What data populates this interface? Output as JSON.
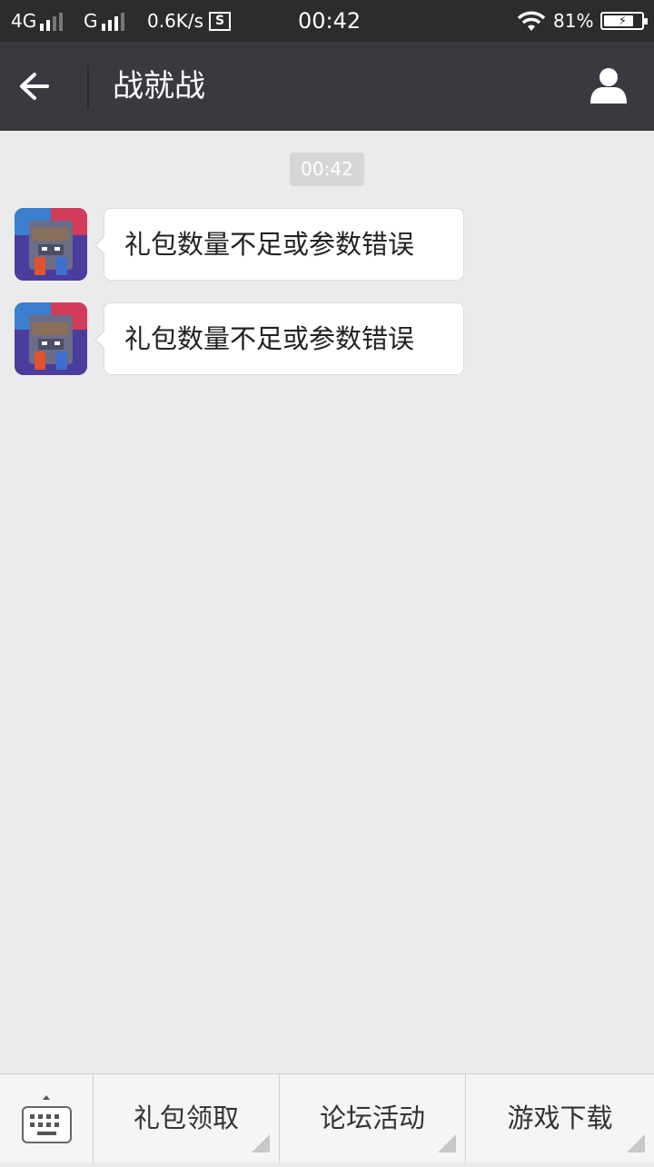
{
  "status_bar": {
    "network1": "4G",
    "network2": "G",
    "speed": "0.6K/s",
    "s_badge": "S",
    "time": "00:42",
    "battery_percent": "81%",
    "battery_level": 0.81,
    "icons": [
      "signal-icon",
      "wifi-icon",
      "battery-charging-icon"
    ]
  },
  "header": {
    "title": "战就战",
    "back_icon": "arrow-left-icon",
    "profile_icon": "person-icon"
  },
  "chat": {
    "timestamp": "00:42",
    "messages": [
      {
        "text": "礼包数量不足或参数错误",
        "avatar": "game-avatar"
      },
      {
        "text": "礼包数量不足或参数错误",
        "avatar": "game-avatar"
      }
    ]
  },
  "menu": {
    "keyboard_icon": "keyboard-icon",
    "items": [
      {
        "label": "礼包领取"
      },
      {
        "label": "论坛活动"
      },
      {
        "label": "游戏下载"
      }
    ]
  },
  "colors": {
    "status_bar_bg": "#2b2c2e",
    "nav_bg": "#393a3f",
    "chat_bg": "#ebebeb",
    "bubble_bg": "#ffffff",
    "menu_bg": "#f5f5f5"
  }
}
